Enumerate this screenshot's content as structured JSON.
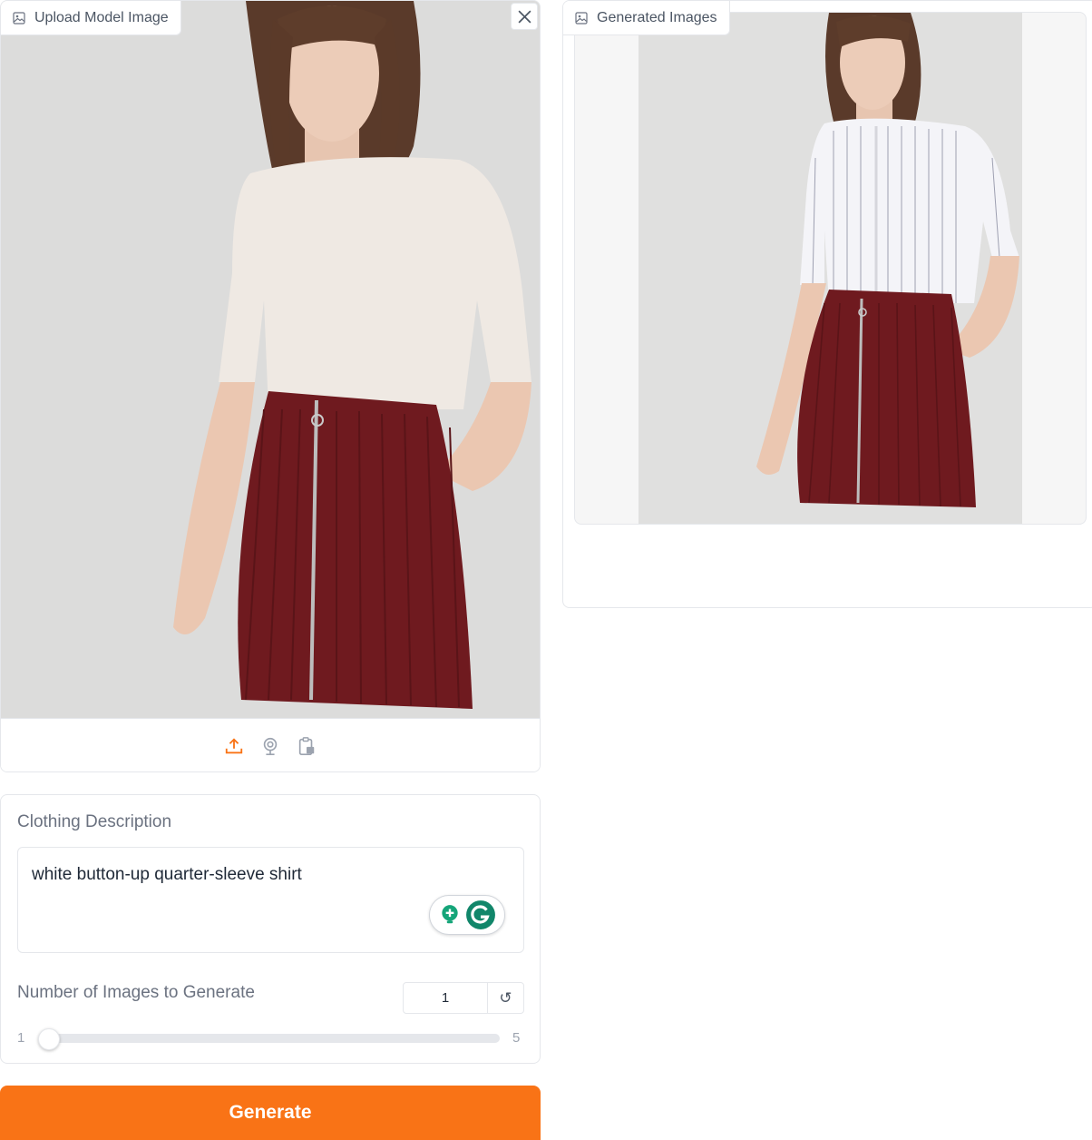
{
  "colors": {
    "accent": "#f97316",
    "border": "#e5e7eb",
    "skirt": "#6f1a1f"
  },
  "upload": {
    "label": "Upload Model Image",
    "label_icon": "image-icon",
    "clear_icon": "close-icon",
    "sources": [
      {
        "name": "upload-icon",
        "active": true
      },
      {
        "name": "webcam-icon",
        "active": false
      },
      {
        "name": "clipboard-icon",
        "active": false
      }
    ]
  },
  "output": {
    "label": "Generated Images",
    "label_icon": "image-icon"
  },
  "form": {
    "description_label": "Clothing Description",
    "description_value": "white button-up quarter-sleeve shirt",
    "count_label": "Number of Images to Generate",
    "count_value": "1",
    "slider_min": "1",
    "slider_max": "5",
    "slider_value": 1,
    "reset_icon": "reset-icon",
    "grammarly_icons": [
      "lightbulb-icon",
      "grammarly-icon"
    ]
  },
  "generate_label": "Generate"
}
